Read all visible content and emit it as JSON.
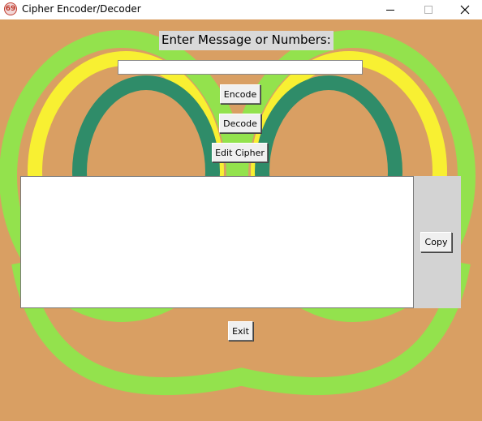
{
  "window": {
    "title": "Cipher Encoder/Decoder",
    "icon_text": "69",
    "controls": [
      "minimize",
      "maximize",
      "close"
    ]
  },
  "prompt": {
    "label": "Enter Message or Numbers:"
  },
  "input": {
    "value": "",
    "placeholder": ""
  },
  "buttons": {
    "encode": "Encode",
    "decode": "Decode",
    "edit_cipher": "Edit Cipher",
    "copy": "Copy",
    "exit": "Exit"
  },
  "output": {
    "text": ""
  },
  "colors": {
    "background": "#d99f63",
    "outer_ring": "#93e24d",
    "middle_ring": "#f8f032",
    "inner_ring": "#2f8c69",
    "label_bg": "#d9d9d9",
    "side_panel": "#d3d3d3"
  }
}
